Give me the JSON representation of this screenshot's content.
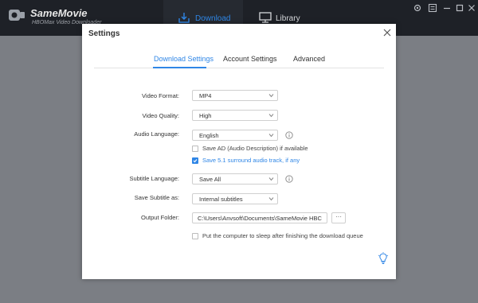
{
  "app": {
    "name": "SameMovie",
    "subtitle": "HBOMax Video Downloader"
  },
  "nav": {
    "download_label": "Download",
    "library_label": "Library"
  },
  "colors": {
    "accent": "#2f86e6",
    "topbar": "#1e2127",
    "overlay": "#7b7e84"
  },
  "dialog": {
    "title": "Settings",
    "tabs": [
      {
        "label": "Download Settings",
        "active": true
      },
      {
        "label": "Account Settings",
        "active": false
      },
      {
        "label": "Advanced",
        "active": false
      }
    ],
    "fields": {
      "video_format": {
        "label": "Video Format:",
        "value": "MP4"
      },
      "video_quality": {
        "label": "Video Quality:",
        "value": "High"
      },
      "audio_language": {
        "label": "Audio Language:",
        "value": "English"
      },
      "save_ad": {
        "label": "Save AD (Audio Description) if available",
        "checked": false
      },
      "save_51": {
        "label": "Save 5.1 surround audio track, if any",
        "checked": true
      },
      "subtitle_language": {
        "label": "Subtitle Language:",
        "value": "Save All"
      },
      "save_subtitle_as": {
        "label": "Save Subtitle as:",
        "value": "Internal subtitles"
      },
      "output_folder": {
        "label": "Output Folder:",
        "value": "C:\\Users\\Anvsoft\\Documents\\SameMovie HBC",
        "button": "···"
      },
      "sleep": {
        "label": "Put the computer to sleep after finishing the download queue",
        "checked": false
      }
    }
  },
  "icons": [
    "logo-icon",
    "download-icon",
    "library-icon",
    "settings-icon",
    "menu-icon",
    "minimize-icon",
    "maximize-icon",
    "close-icon",
    "chevron-down-icon",
    "info-icon",
    "check-icon",
    "bulb-icon"
  ]
}
